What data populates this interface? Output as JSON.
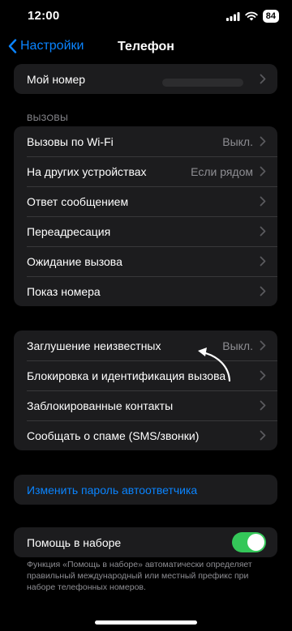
{
  "status": {
    "time": "12:00",
    "battery": "84"
  },
  "nav": {
    "back_label": "Настройки",
    "title": "Телефон"
  },
  "my_number": {
    "label": "Мой номер"
  },
  "calls_section": {
    "header": "ВЫЗОВЫ",
    "rows": [
      {
        "label": "Вызовы по Wi-Fi",
        "value": "Выкл."
      },
      {
        "label": "На других устройствах",
        "value": "Если рядом"
      },
      {
        "label": "Ответ сообщением",
        "value": ""
      },
      {
        "label": "Переадресация",
        "value": ""
      },
      {
        "label": "Ожидание вызова",
        "value": ""
      },
      {
        "label": "Показ номера",
        "value": ""
      }
    ]
  },
  "block_section": {
    "rows": [
      {
        "label": "Заглушение неизвестных",
        "value": "Выкл."
      },
      {
        "label": "Блокировка и идентификация вызова",
        "value": ""
      },
      {
        "label": "Заблокированные контакты",
        "value": ""
      },
      {
        "label": "Сообщать о спаме (SMS/звонки)",
        "value": ""
      }
    ]
  },
  "voicemail": {
    "label": "Изменить пароль автоответчика"
  },
  "dial_assist": {
    "label": "Помощь в наборе",
    "enabled": true,
    "footer": "Функция «Помощь в наборе» автоматически определяет правильный международный или местный префикс при наборе телефонных номеров."
  },
  "colors": {
    "accent": "#0a84ff",
    "toggle_on": "#34c759",
    "cell_bg": "#1c1c1e"
  }
}
